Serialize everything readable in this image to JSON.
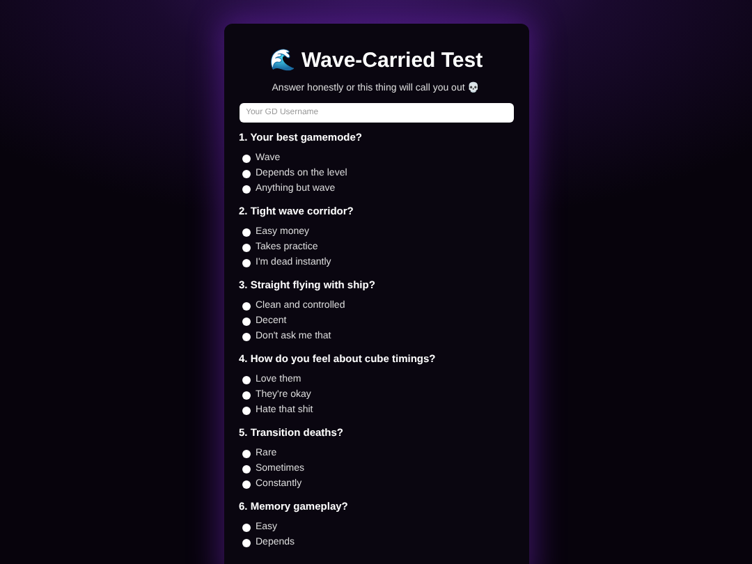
{
  "title": "🌊 Wave-Carried Test",
  "subtitle": "Answer honestly or this thing will call you out 💀",
  "username_field": {
    "placeholder": "Your GD Username"
  },
  "questions": [
    {
      "label": "1. Your best gamemode?",
      "options": [
        {
          "label": "Wave",
          "selected": false
        },
        {
          "label": "Depends on the level",
          "selected": false
        },
        {
          "label": "Anything but wave",
          "selected": false
        }
      ]
    },
    {
      "label": "2. Tight wave corridor?",
      "options": [
        {
          "label": "Easy money",
          "selected": false
        },
        {
          "label": "Takes practice",
          "selected": false
        },
        {
          "label": "I'm dead instantly",
          "selected": false
        }
      ]
    },
    {
      "label": "3. Straight flying with ship?",
      "options": [
        {
          "label": "Clean and controlled",
          "selected": false
        },
        {
          "label": "Decent",
          "selected": false
        },
        {
          "label": "Don't ask me that",
          "selected": false
        }
      ]
    },
    {
      "label": "4. How do you feel about cube timings?",
      "options": [
        {
          "label": "Love them",
          "selected": false
        },
        {
          "label": "They're okay",
          "selected": false
        },
        {
          "label": "Hate that shit",
          "selected": false
        }
      ]
    },
    {
      "label": "5. Transition deaths?",
      "options": [
        {
          "label": "Rare",
          "selected": false
        },
        {
          "label": "Sometimes",
          "selected": false
        },
        {
          "label": "Constantly",
          "selected": false
        }
      ]
    },
    {
      "label": "6. Memory gameplay?",
      "options": [
        {
          "label": "Easy",
          "selected": false
        },
        {
          "label": "Depends",
          "selected": false
        }
      ]
    }
  ]
}
